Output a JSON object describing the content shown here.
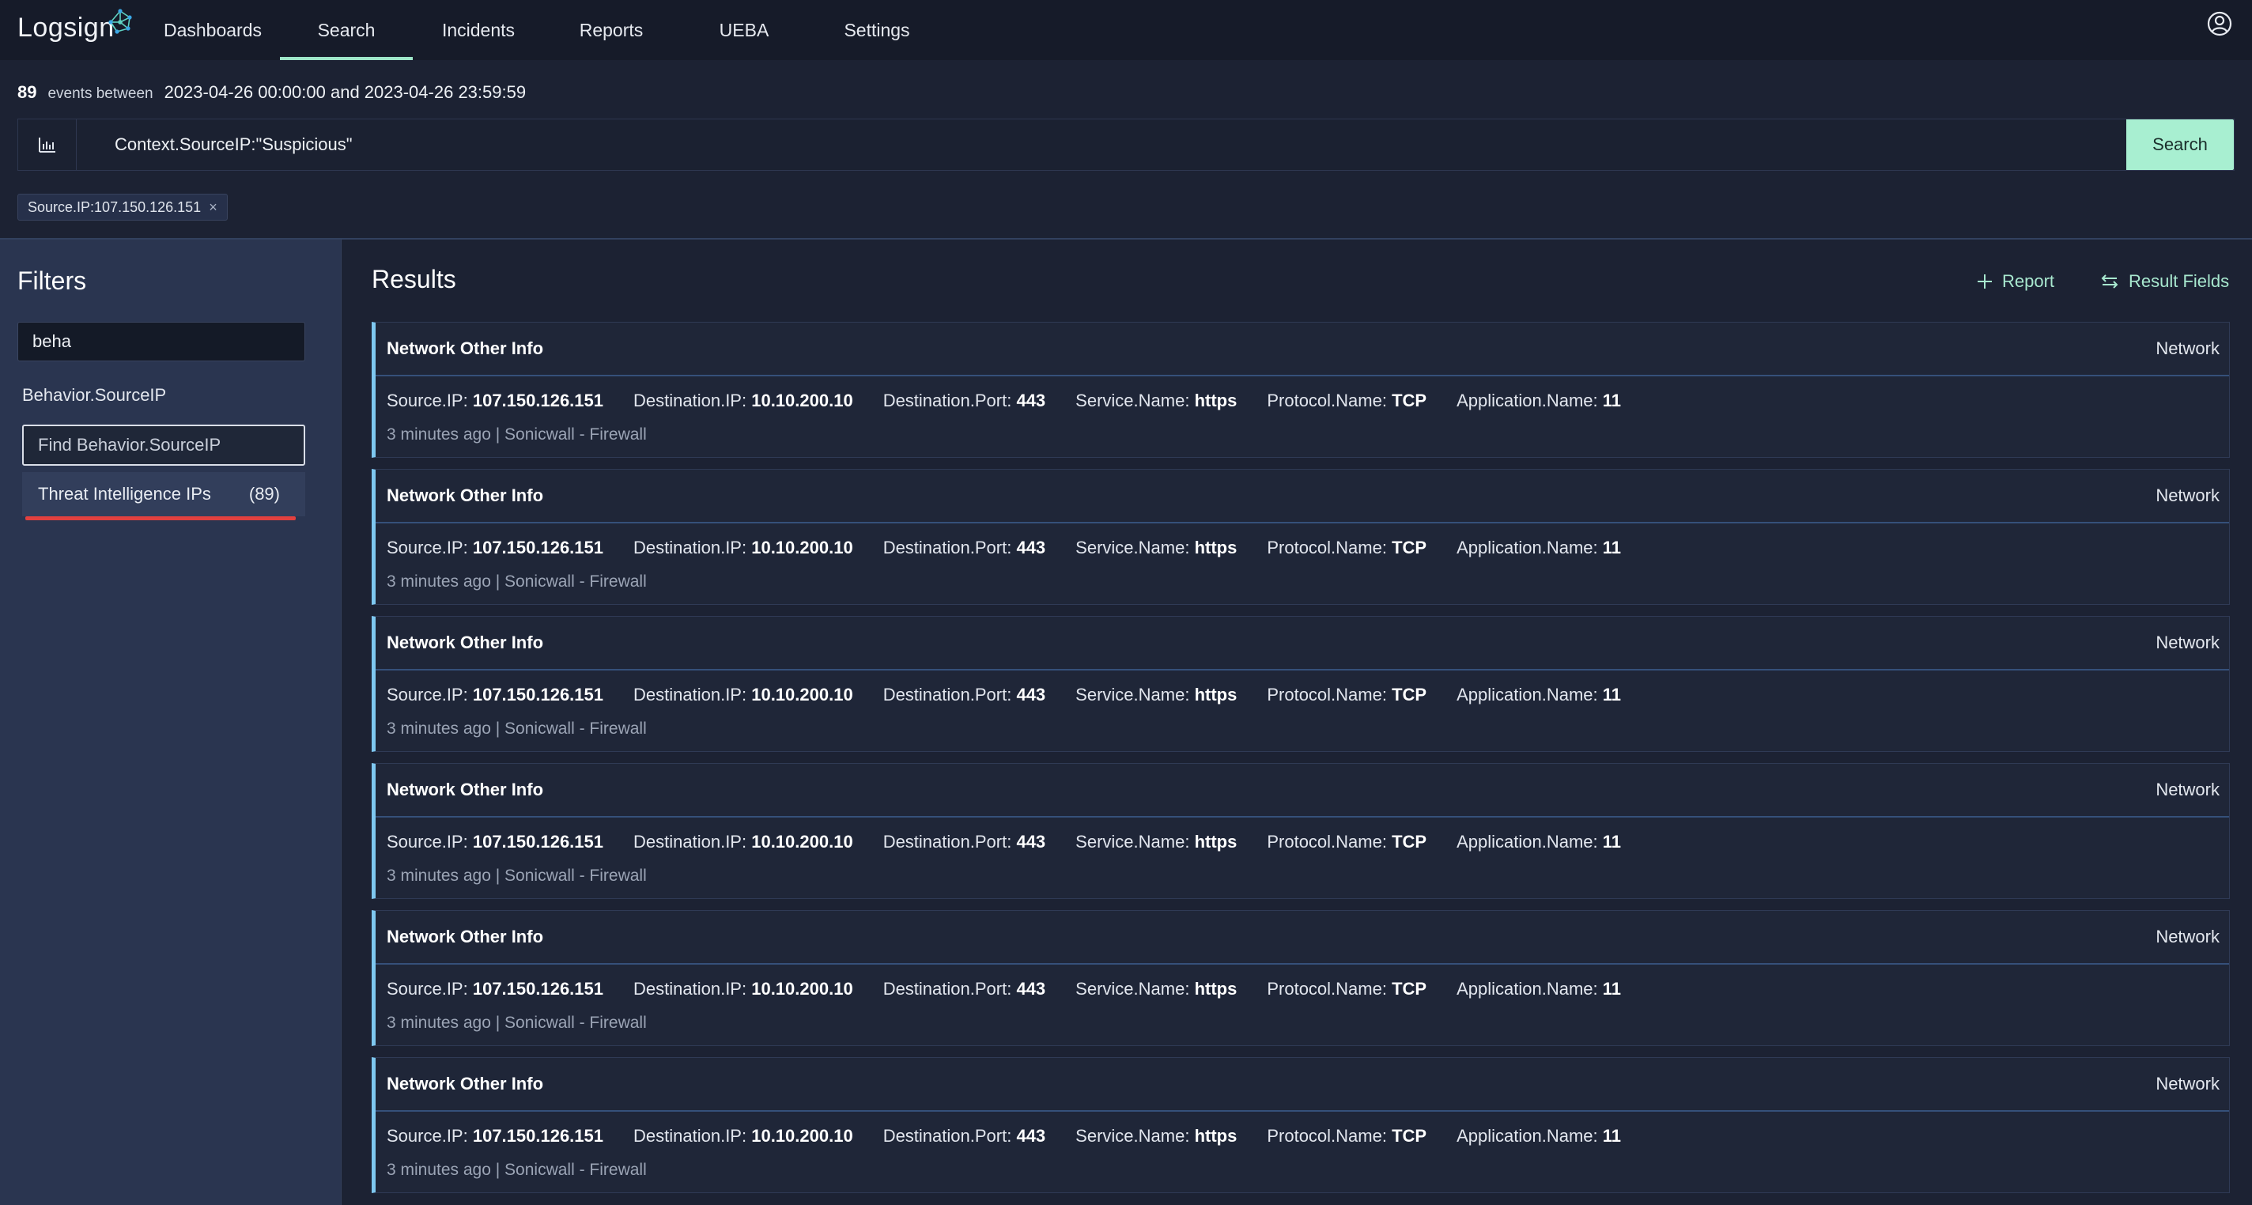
{
  "brand": {
    "logo_text": "Logsign"
  },
  "nav": {
    "items": [
      {
        "label": "Dashboards",
        "active": false
      },
      {
        "label": "Search",
        "active": true
      },
      {
        "label": "Incidents",
        "active": false
      },
      {
        "label": "Reports",
        "active": false
      },
      {
        "label": "UEBA",
        "active": false
      },
      {
        "label": "Settings",
        "active": false
      }
    ],
    "account_icon": "user-circle-icon"
  },
  "search": {
    "event_count": "89",
    "events_label": "events between",
    "range_text": "2023-04-26 00:00:00 and 2023-04-26 23:59:59",
    "query": "Context.SourceIP:\"Suspicious\"",
    "button_label": "Search",
    "chart_icon": "bar-chart-icon",
    "active_filter_chip": "Source.IP:107.150.126.151",
    "chip_remove": "×"
  },
  "filters": {
    "title": "Filters",
    "search_value": "beha",
    "facet_title": "Behavior.SourceIP",
    "facet_find_placeholder": "Find Behavior.SourceIP",
    "options": [
      {
        "label": "Threat Intelligence IPs",
        "count": "(89)"
      }
    ]
  },
  "results": {
    "title": "Results",
    "report_label": "Report",
    "fields_label": "Result Fields",
    "items": [
      {
        "title": "Network Other Info",
        "category": "Network",
        "source_ip": "107.150.126.151",
        "dest_ip": "10.10.200.10",
        "dest_port": "443",
        "service": "https",
        "protocol": "TCP",
        "app": "11",
        "meta": "3 minutes ago | Sonicwall - Firewall"
      },
      {
        "title": "Network Other Info",
        "category": "Network",
        "source_ip": "107.150.126.151",
        "dest_ip": "10.10.200.10",
        "dest_port": "443",
        "service": "https",
        "protocol": "TCP",
        "app": "11",
        "meta": "3 minutes ago | Sonicwall - Firewall"
      },
      {
        "title": "Network Other Info",
        "category": "Network",
        "source_ip": "107.150.126.151",
        "dest_ip": "10.10.200.10",
        "dest_port": "443",
        "service": "https",
        "protocol": "TCP",
        "app": "11",
        "meta": "3 minutes ago | Sonicwall - Firewall"
      },
      {
        "title": "Network Other Info",
        "category": "Network",
        "source_ip": "107.150.126.151",
        "dest_ip": "10.10.200.10",
        "dest_port": "443",
        "service": "https",
        "protocol": "TCP",
        "app": "11",
        "meta": "3 minutes ago | Sonicwall - Firewall"
      },
      {
        "title": "Network Other Info",
        "category": "Network",
        "source_ip": "107.150.126.151",
        "dest_ip": "10.10.200.10",
        "dest_port": "443",
        "service": "https",
        "protocol": "TCP",
        "app": "11",
        "meta": "3 minutes ago | Sonicwall - Firewall"
      },
      {
        "title": "Network Other Info",
        "category": "Network",
        "source_ip": "107.150.126.151",
        "dest_ip": "10.10.200.10",
        "dest_port": "443",
        "service": "https",
        "protocol": "TCP",
        "app": "11",
        "meta": "3 minutes ago | Sonicwall - Firewall"
      }
    ],
    "field_labels": {
      "source_ip": "Source.IP:",
      "dest_ip": "Destination.IP:",
      "dest_port": "Destination.Port:",
      "service": "Service.Name:",
      "protocol": "Protocol.Name:",
      "app": "Application.Name:"
    }
  },
  "colors": {
    "accent": "#9ee6c8",
    "search_button": "#a8efd1",
    "card_border_left": "#7ec8f0",
    "option_underline": "#e2403f"
  }
}
